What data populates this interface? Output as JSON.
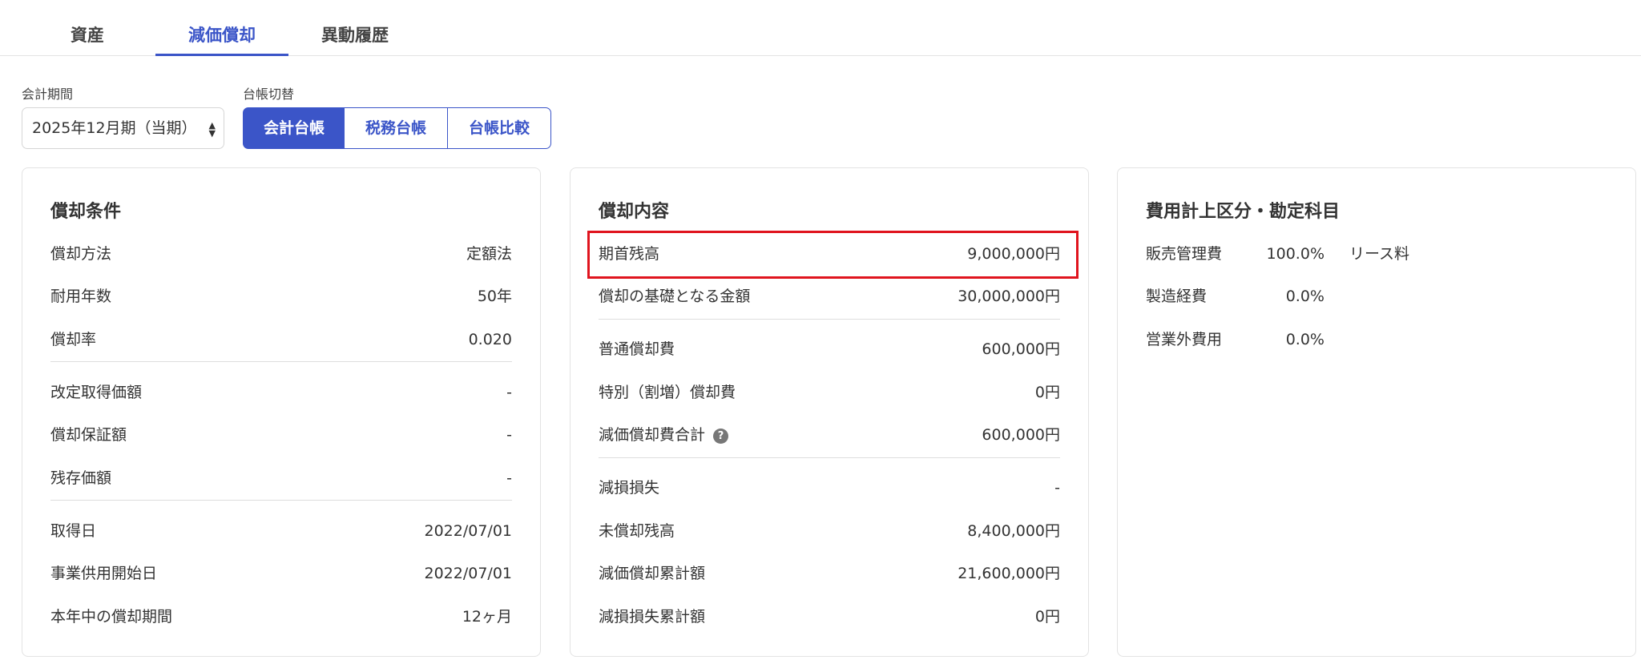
{
  "tabs": [
    {
      "label": "資産",
      "active": false
    },
    {
      "label": "減価償却",
      "active": true
    },
    {
      "label": "異動履歴",
      "active": false
    }
  ],
  "controls": {
    "period_label": "会計期間",
    "period_value": "2025年12月期（当期）",
    "ledger_label": "台帳切替",
    "ledger_options": [
      "会計台帳",
      "税務台帳",
      "台帳比較"
    ],
    "ledger_selected": "会計台帳"
  },
  "conditions": {
    "title": "償却条件",
    "rows": [
      {
        "label": "償却方法",
        "value": "定額法"
      },
      {
        "label": "耐用年数",
        "value": "50年"
      },
      {
        "label": "償却率",
        "value": "0.020"
      },
      {
        "label": "改定取得価額",
        "value": "-"
      },
      {
        "label": "償却保証額",
        "value": "-"
      },
      {
        "label": "残存価額",
        "value": "-"
      },
      {
        "label": "取得日",
        "value": "2022/07/01"
      },
      {
        "label": "事業供用開始日",
        "value": "2022/07/01"
      },
      {
        "label": "本年中の償却期間",
        "value": "12ヶ月"
      }
    ]
  },
  "details": {
    "title": "償却内容",
    "rows": [
      {
        "label": "期首残高",
        "value": "9,000,000円"
      },
      {
        "label": "償却の基礎となる金額",
        "value": "30,000,000円"
      },
      {
        "label": "普通償却費",
        "value": "600,000円"
      },
      {
        "label": "特別（割増）償却費",
        "value": "0円"
      },
      {
        "label": "減価償却費合計",
        "value": "600,000円"
      },
      {
        "label": "減損損失",
        "value": "-"
      },
      {
        "label": "未償却残高",
        "value": "8,400,000円"
      },
      {
        "label": "減価償却累計額",
        "value": "21,600,000円"
      },
      {
        "label": "減損損失累計額",
        "value": "0円"
      }
    ],
    "help_glyph": "?"
  },
  "expense": {
    "title": "費用計上区分・勘定科目",
    "rows": [
      {
        "label": "販売管理費",
        "percent": "100.0%",
        "account": "リース料"
      },
      {
        "label": "製造経費",
        "percent": "0.0%",
        "account": ""
      },
      {
        "label": "営業外費用",
        "percent": "0.0%",
        "account": ""
      }
    ]
  },
  "colors": {
    "accent": "#3b55c8",
    "highlight": "#e0141e"
  }
}
